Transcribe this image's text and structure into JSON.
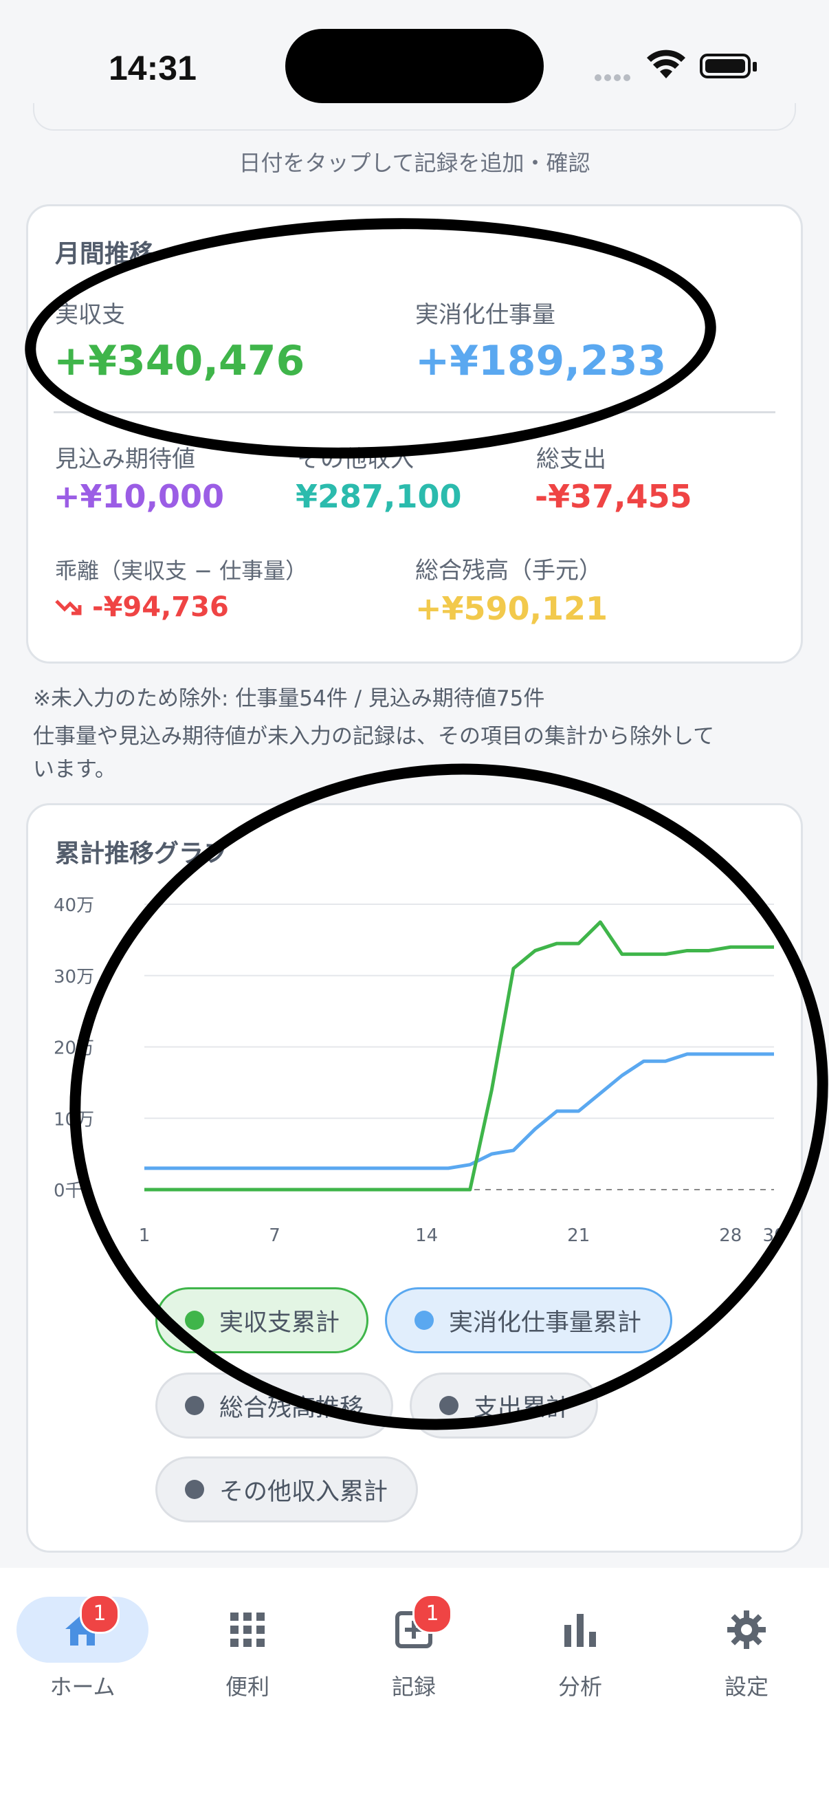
{
  "status": {
    "time": "14:31"
  },
  "hint": "日付をタップして記録を追加・確認",
  "monthly": {
    "title": "月間推移",
    "real_income_label": "実収支",
    "real_income_value": "+¥340,476",
    "realized_label": "実消化仕事量",
    "realized_value": "+¥189,233",
    "expected_label": "見込み期待値",
    "expected_value": "+¥10,000",
    "other_label": "その他収入",
    "other_value": "¥287,100",
    "expense_label": "総支出",
    "expense_value": "-¥37,455",
    "gap_label": "乖離（実収支 − 仕事量）",
    "gap_value": "-¥94,736",
    "balance_label": "総合残高（手元）",
    "balance_value": "+¥590,121"
  },
  "notes": {
    "line1": "※未入力のため除外: 仕事量54件 / 見込み期待値75件",
    "line2": "仕事量や見込み期待値が未入力の記録は、その項目の集計から除外して",
    "line3": "います。"
  },
  "graph": {
    "title": "累計推移グラフ"
  },
  "chart_data": {
    "type": "line",
    "ytick_labels": [
      "40万",
      "30万",
      "20万",
      "10万",
      "0千"
    ],
    "xtick_labels": [
      "1",
      "7",
      "14",
      "21",
      "28",
      "30"
    ],
    "ylim": [
      0,
      400000
    ],
    "x": [
      1,
      2,
      3,
      4,
      5,
      6,
      7,
      8,
      9,
      10,
      11,
      12,
      13,
      14,
      15,
      16,
      17,
      18,
      19,
      20,
      21,
      22,
      23,
      24,
      25,
      26,
      27,
      28,
      29,
      30
    ],
    "series": [
      {
        "name": "実収支累計",
        "color": "#3fb54a",
        "values": [
          0,
          0,
          0,
          0,
          0,
          0,
          0,
          0,
          0,
          0,
          0,
          0,
          0,
          0,
          0,
          0,
          140000,
          310000,
          335000,
          345000,
          345000,
          375000,
          330000,
          330000,
          330000,
          335000,
          335000,
          340000,
          340000,
          340000
        ]
      },
      {
        "name": "実消化仕事量累計",
        "color": "#5aa8f0",
        "values": [
          30000,
          30000,
          30000,
          30000,
          30000,
          30000,
          30000,
          30000,
          30000,
          30000,
          30000,
          30000,
          30000,
          30000,
          30000,
          35000,
          50000,
          55000,
          85000,
          110000,
          110000,
          135000,
          160000,
          180000,
          180000,
          190000,
          190000,
          190000,
          190000,
          190000
        ]
      }
    ],
    "legend": [
      {
        "label": "実収支累計",
        "color": "#3fb54a",
        "active": true
      },
      {
        "label": "実消化仕事量累計",
        "color": "#5aa8f0",
        "active": true
      },
      {
        "label": "総合残高推移",
        "color": "#5b6472",
        "active": false
      },
      {
        "label": "支出累計",
        "color": "#5b6472",
        "active": false
      },
      {
        "label": "その他収入累計",
        "color": "#5b6472",
        "active": false
      }
    ]
  },
  "tabs": [
    {
      "label": "ホーム",
      "badge": "1"
    },
    {
      "label": "便利"
    },
    {
      "label": "記録",
      "badge": "1"
    },
    {
      "label": "分析"
    },
    {
      "label": "設定"
    }
  ],
  "colors": {
    "green": "#3fb54a",
    "blue": "#5aa8f0",
    "purple": "#9b5de5",
    "teal": "#2bbbad",
    "red": "#ef4444",
    "yellow": "#f2c94c"
  }
}
